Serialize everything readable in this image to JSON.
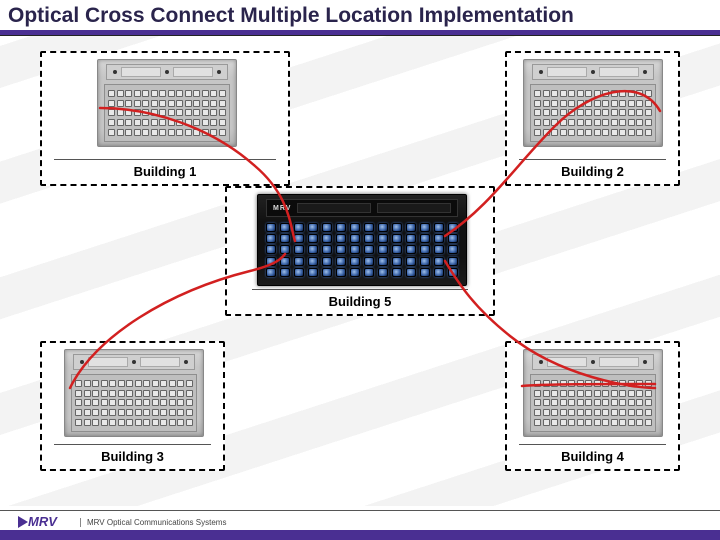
{
  "title": "Optical Cross Connect Multiple Location Implementation",
  "buildings": {
    "b1": {
      "label": "Building 1"
    },
    "b2": {
      "label": "Building 2"
    },
    "b3": {
      "label": "Building 3"
    },
    "b4": {
      "label": "Building 4"
    },
    "b5": {
      "label": "Building 5"
    }
  },
  "devices": {
    "gray_switch_rows": 5,
    "gray_switch_cols": 14,
    "central_switch_brand": "MRV",
    "central_switch_rows": 5,
    "central_switch_cols": 14
  },
  "footer": {
    "brand": "MRV",
    "tagline": "MRV Optical Communications Systems"
  },
  "colors": {
    "accent": "#4a2f92",
    "cable": "#d22020"
  }
}
